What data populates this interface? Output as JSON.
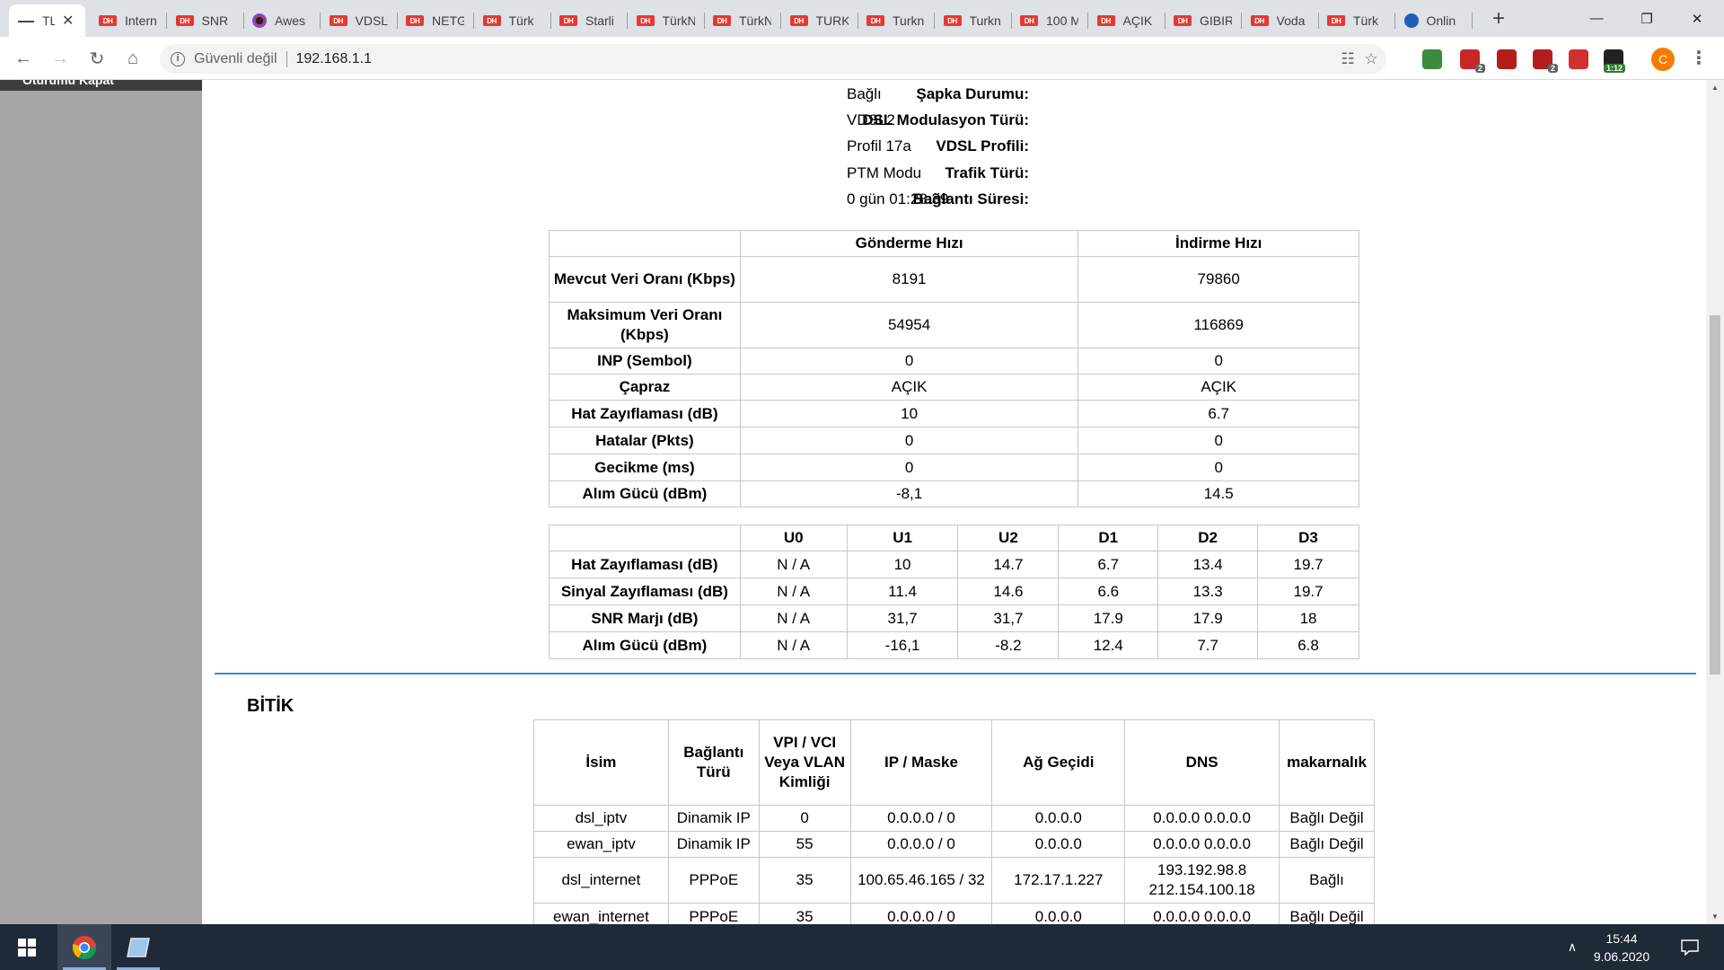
{
  "browser": {
    "tabs": [
      {
        "title": "TL",
        "icon": "router-icon",
        "active": true
      },
      {
        "title": "Intern",
        "icon": "dh-icon"
      },
      {
        "title": "SNR",
        "icon": "dh-icon"
      },
      {
        "title": "Awes",
        "icon": "color-circle-icon"
      },
      {
        "title": "VDSL",
        "icon": "dh-icon"
      },
      {
        "title": "NETG",
        "icon": "dh-icon"
      },
      {
        "title": "Türk",
        "icon": "dh-icon"
      },
      {
        "title": "Starli",
        "icon": "dh-icon"
      },
      {
        "title": "TürkN",
        "icon": "dh-icon"
      },
      {
        "title": "TürkN",
        "icon": "dh-icon"
      },
      {
        "title": "TURK",
        "icon": "dh-icon"
      },
      {
        "title": "Turkn",
        "icon": "dh-icon"
      },
      {
        "title": "Turkn",
        "icon": "dh-icon"
      },
      {
        "title": "100 M",
        "icon": "dh-icon"
      },
      {
        "title": "AÇIK",
        "icon": "dh-icon"
      },
      {
        "title": "GIBIR",
        "icon": "dh-icon"
      },
      {
        "title": "Voda",
        "icon": "dh-icon"
      },
      {
        "title": "Türk",
        "icon": "dh-icon"
      },
      {
        "title": "Onlin",
        "icon": "bird-icon"
      }
    ],
    "security_label": "Güvenli değil",
    "url": "192.168.1.1",
    "profile_initial": "C",
    "extensions": [
      {
        "name": "globe-extension-icon",
        "color": "#3b8a3e",
        "badge": ""
      },
      {
        "name": "shield-extension-icon",
        "color": "#c62828",
        "badge": "2"
      },
      {
        "name": "d-extension-icon",
        "color": "#b71c1c",
        "badge": ""
      },
      {
        "name": "ublock-extension-icon",
        "color": "#b71c1c",
        "badge": "2"
      },
      {
        "name": "play-extension-icon",
        "color": "#d32f2f",
        "badge": ""
      },
      {
        "name": "timer-extension-icon",
        "color": "#222222",
        "badge": "1:12"
      }
    ]
  },
  "sidebar": {
    "cut_label": "Oturumu Kapat"
  },
  "status": [
    {
      "label": "Şapka Durumu:",
      "value": "Bağlı"
    },
    {
      "label": "DSL Modulasyon Türü:",
      "value": "VDSL2"
    },
    {
      "label": "VDSL Profili:",
      "value": "Profil 17a"
    },
    {
      "label": "Trafik Türü:",
      "value": "PTM Modu"
    },
    {
      "label": "Bağlantı Süresi:",
      "value": "0 gün 01:28:39"
    }
  ],
  "rate_table": {
    "headers": [
      "",
      "Gönderme Hızı",
      "İndirme Hızı"
    ],
    "rows": [
      {
        "label": "Mevcut Veri Oranı (Kbps)",
        "up": "8191",
        "down": "79860"
      },
      {
        "label": "Maksimum Veri Oranı (Kbps)",
        "up": "54954",
        "down": "116869"
      },
      {
        "label": "INP (Sembol)",
        "up": "0",
        "down": "0"
      },
      {
        "label": "Çapraz",
        "up": "AÇIK",
        "down": "AÇIK"
      },
      {
        "label": "Hat Zayıflaması (dB)",
        "up": "10",
        "down": "6.7"
      },
      {
        "label": "Hatalar (Pkts)",
        "up": "0",
        "down": "0"
      },
      {
        "label": "Gecikme (ms)",
        "up": "0",
        "down": "0"
      },
      {
        "label": "Alım Gücü (dBm)",
        "up": "-8,1",
        "down": "14.5"
      }
    ]
  },
  "band_table": {
    "headers": [
      "",
      "U0",
      "U1",
      "U2",
      "D1",
      "D2",
      "D3"
    ],
    "rows": [
      {
        "label": "Hat Zayıflaması (dB)",
        "cells": [
          "N / A",
          "10",
          "14.7",
          "6.7",
          "13.4",
          "19.7"
        ]
      },
      {
        "label": "Sinyal Zayıflaması (dB)",
        "cells": [
          "N / A",
          "11.4",
          "14.6",
          "6.6",
          "13.3",
          "19.7"
        ]
      },
      {
        "label": "SNR Marjı (dB)",
        "cells": [
          "N / A",
          "31,7",
          "31,7",
          "17.9",
          "17.9",
          "18"
        ]
      },
      {
        "label": "Alım Gücü (dBm)",
        "cells": [
          "N / A",
          "-16,1",
          "-8.2",
          "12.4",
          "7.7",
          "6.8"
        ]
      }
    ]
  },
  "wan": {
    "title": "BİTİK",
    "headers": [
      "İsim",
      "Bağlantı Türü",
      "VPI / VCI Veya VLAN Kimliği",
      "IP / Maske",
      "Ağ Geçidi",
      "DNS",
      "makarnalık"
    ],
    "rows": [
      {
        "name": "dsl_iptv",
        "type": "Dinamik IP",
        "vlan": "0",
        "ip": "0.0.0.0 / 0",
        "gateway": "0.0.0.0",
        "dns": "0.0.0.0 0.0.0.0",
        "status": "Bağlı Değil"
      },
      {
        "name": "ewan_iptv",
        "type": "Dinamik IP",
        "vlan": "55",
        "ip": "0.0.0.0 / 0",
        "gateway": "0.0.0.0",
        "dns": "0.0.0.0 0.0.0.0",
        "status": "Bağlı Değil"
      },
      {
        "name": "dsl_internet",
        "type": "PPPoE",
        "vlan": "35",
        "ip": "100.65.46.165 / 32",
        "gateway": "172.17.1.227",
        "dns": "193.192.98.8 212.154.100.18",
        "status": "Bağlı"
      },
      {
        "name": "ewan_internet",
        "type": "PPPoE",
        "vlan": "35",
        "ip": "0.0.0.0 / 0",
        "gateway": "0.0.0.0",
        "dns": "0.0.0.0 0.0.0.0",
        "status": "Bağlı Değil"
      }
    ]
  },
  "taskbar": {
    "time": "15:44",
    "date": "9.06.2020"
  }
}
